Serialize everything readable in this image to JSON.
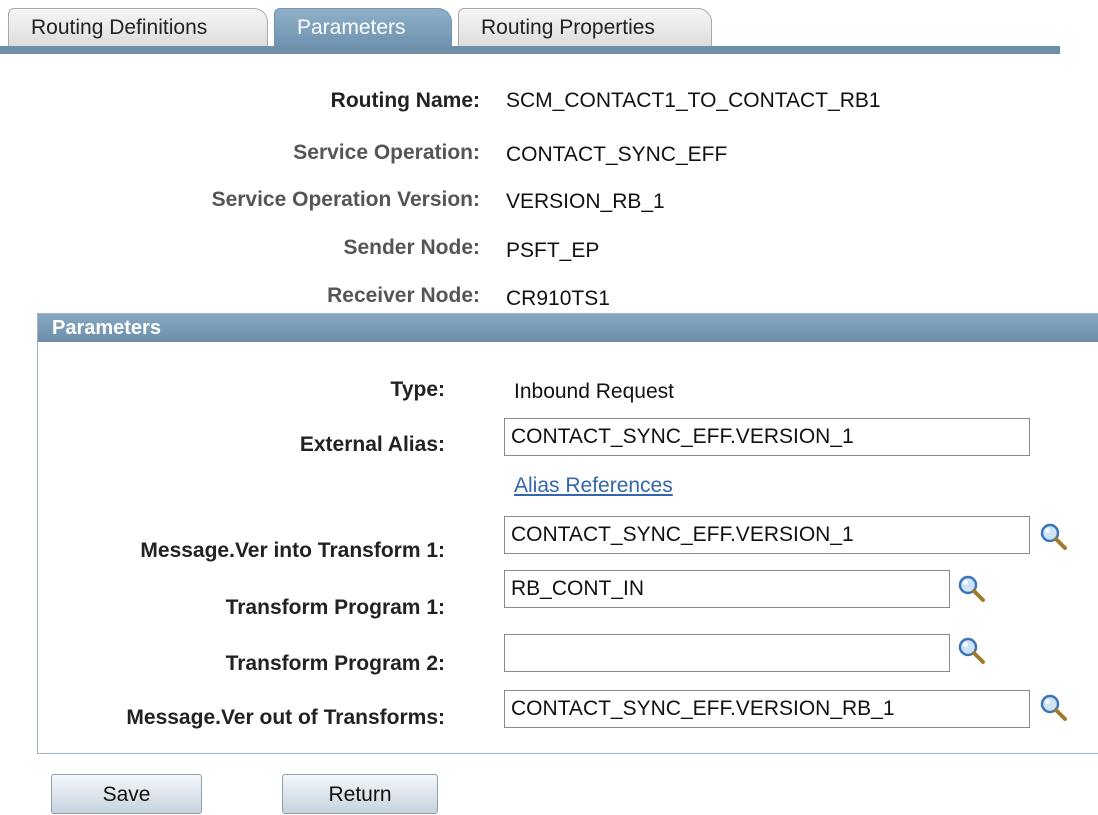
{
  "tabs": [
    {
      "label": "Routing Definitions",
      "active": false
    },
    {
      "label": "Parameters",
      "active": true
    },
    {
      "label": "Routing Properties",
      "active": false
    }
  ],
  "info": {
    "routing_name_label": "Routing Name:",
    "routing_name_value": "SCM_CONTACT1_TO_CONTACT_RB1",
    "service_operation_label": "Service Operation:",
    "service_operation_value": "CONTACT_SYNC_EFF",
    "service_operation_version_label": "Service Operation Version:",
    "service_operation_version_value": "VERSION_RB_1",
    "sender_node_label": "Sender Node:",
    "sender_node_value": "PSFT_EP",
    "receiver_node_label": "Receiver Node:",
    "receiver_node_value": "CR910TS1"
  },
  "parameters": {
    "header": "Parameters",
    "type_label": "Type:",
    "type_value": "Inbound Request",
    "external_alias_label": "External Alias:",
    "external_alias_value": "CONTACT_SYNC_EFF.VERSION_1",
    "alias_references_link": "Alias References",
    "msg_into_transform_label": "Message.Ver into Transform 1:",
    "msg_into_transform_value": "CONTACT_SYNC_EFF.VERSION_1",
    "transform_program_1_label": "Transform Program 1:",
    "transform_program_1_value": "RB_CONT_IN",
    "transform_program_2_label": "Transform Program 2:",
    "transform_program_2_value": "",
    "msg_out_of_transforms_label": "Message.Ver out of Transforms:",
    "msg_out_of_transforms_value": "CONTACT_SYNC_EFF.VERSION_RB_1"
  },
  "buttons": {
    "save_label": "Save",
    "return_label": "Return"
  },
  "colors": {
    "accent": "#6f8ea8",
    "link": "#3366aa"
  },
  "icons": {
    "lookup": "magnifier-lookup-icon"
  }
}
